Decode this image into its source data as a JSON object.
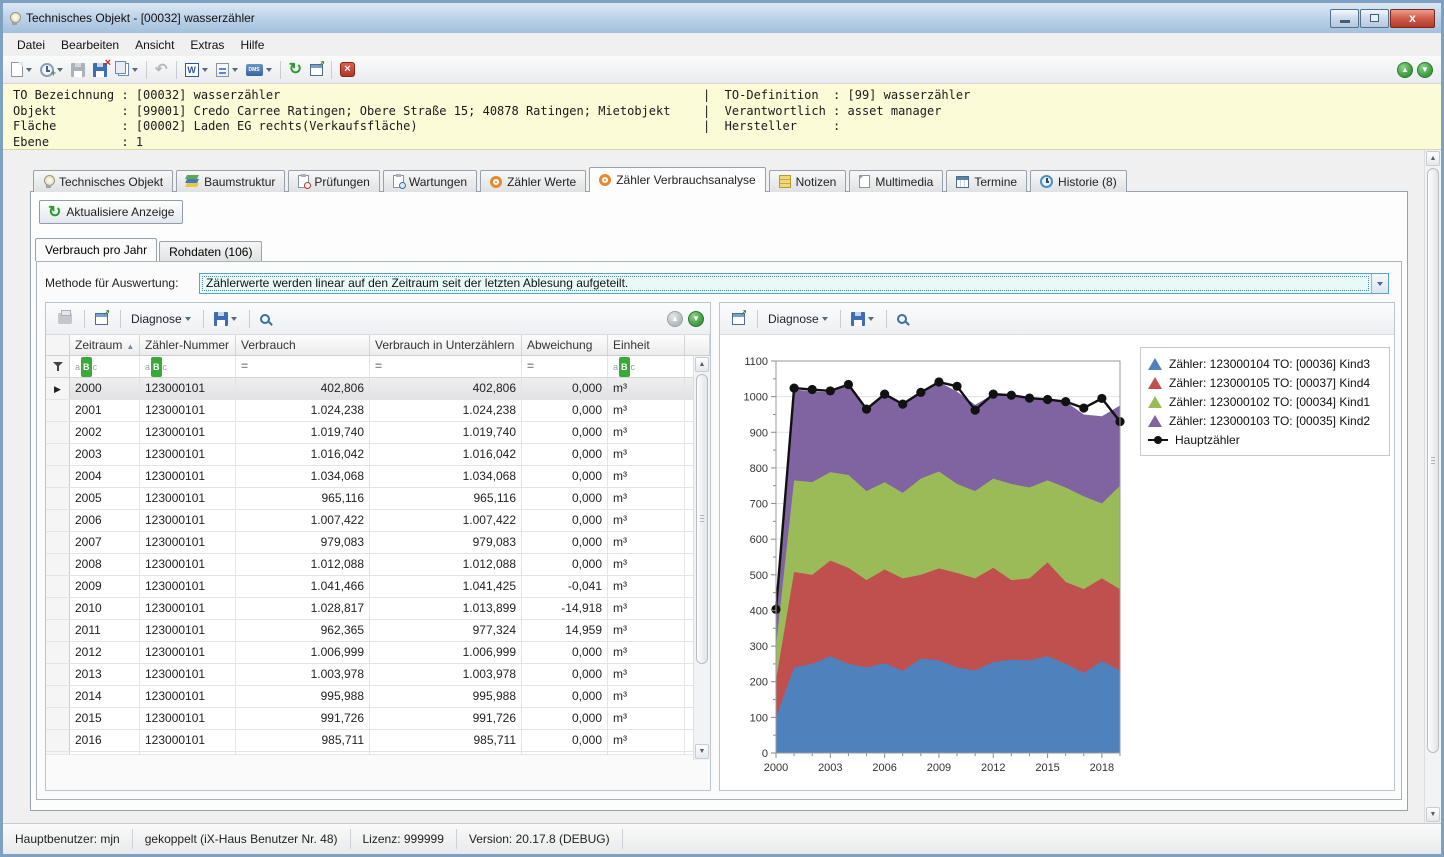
{
  "window": {
    "title": "Technisches Objekt - [00032] wasserzähler"
  },
  "menu": {
    "items": [
      "Datei",
      "Bearbeiten",
      "Ansicht",
      "Extras",
      "Hilfe"
    ]
  },
  "toolbar": {
    "buttons": [
      {
        "icon": "new-document-icon",
        "dropdown": true
      },
      {
        "icon": "history-clock-icon",
        "dropdown": true
      },
      {
        "icon": "save-icon",
        "disabled": true
      },
      {
        "icon": "save-discard-icon"
      },
      {
        "icon": "copy-icon",
        "dropdown": true
      },
      {
        "sep": true
      },
      {
        "icon": "undo-icon",
        "disabled": true,
        "glyph": "↶"
      },
      {
        "sep": true
      },
      {
        "icon": "word-export-icon",
        "dropdown": true,
        "glyph": "W"
      },
      {
        "icon": "list-report-icon",
        "dropdown": true
      },
      {
        "icon": "dms-icon",
        "dropdown": true,
        "glyph": "DMS"
      },
      {
        "sep": true
      },
      {
        "icon": "refresh-icon",
        "glyph": "↻"
      },
      {
        "icon": "detach-window-icon"
      },
      {
        "sep": true
      },
      {
        "icon": "delete-icon",
        "glyph": "×"
      }
    ],
    "nav_buttons": [
      {
        "icon": "nav-up-icon",
        "glyph": "▲"
      },
      {
        "icon": "nav-down-icon",
        "glyph": "▼"
      }
    ]
  },
  "info_panel": {
    "left_lines": [
      "TO Bezeichnung : [00032] wasserzähler",
      "Objekt         : [99001] Credo Carree Ratingen; Obere Straße 15; 40878 Ratingen; Mietobjekt",
      "Fläche         : [00002] Laden EG rechts(Verkaufsfläche)",
      "Ebene          : 1"
    ],
    "right_lines": [
      "|  TO-Definition  : [99] wasserzähler",
      "|  Verantwortlich : asset manager",
      "|  Hersteller     :"
    ]
  },
  "tabs": [
    {
      "label": "Technisches Objekt",
      "icon": "bulb-icon",
      "active": false
    },
    {
      "label": "Baumstruktur",
      "icon": "tree-layers-icon",
      "active": false
    },
    {
      "label": "Prüfungen",
      "icon": "clipboard-check-icon",
      "active": false
    },
    {
      "label": "Wartungen",
      "icon": "clipboard-search-icon",
      "active": false
    },
    {
      "label": "Zähler Werte",
      "icon": "meter-icon",
      "active": false
    },
    {
      "label": "Zähler Verbrauchsanalyse",
      "icon": "meter-icon",
      "active": true
    },
    {
      "label": "Notizen",
      "icon": "notes-icon",
      "active": false
    },
    {
      "label": "Multimedia",
      "icon": "multimedia-icon",
      "active": false
    },
    {
      "label": "Termine",
      "icon": "calendar-icon",
      "active": false
    },
    {
      "label": "Historie (8)",
      "icon": "history-tab-icon",
      "active": false
    }
  ],
  "actions": {
    "refresh_view": "Aktualisiere Anzeige"
  },
  "sub_tabs": [
    {
      "label": "Verbrauch pro Jahr",
      "active": true
    },
    {
      "label": "Rohdaten (106)",
      "active": false
    }
  ],
  "methode": {
    "label": "Methode für Auswertung:",
    "value": "Zählerwerte werden linear auf den Zeitraum seit der letzten Ablesung aufgeteilt."
  },
  "grid_toolbar_left": {
    "buttons": [
      {
        "icon": "print-icon",
        "disabled": true
      },
      {
        "icon": "detach-window-icon"
      },
      {
        "label": "Diagnose",
        "dropdown": true
      },
      {
        "icon": "save-layout-icon",
        "dropdown": true
      },
      {
        "icon": "search-icon"
      }
    ],
    "nav": [
      {
        "icon": "up-circle-icon",
        "disabled": true,
        "glyph": "▲"
      },
      {
        "icon": "down-circle-icon",
        "glyph": "▼"
      }
    ]
  },
  "grid_toolbar_right": {
    "buttons": [
      {
        "icon": "detach-window-icon"
      },
      {
        "label": "Diagnose",
        "dropdown": true
      },
      {
        "icon": "save-layout-icon",
        "dropdown": true
      },
      {
        "icon": "search-icon"
      }
    ]
  },
  "table": {
    "columns": [
      {
        "label": "Zeitraum",
        "sort": "asc",
        "filter": "abc",
        "align": "left"
      },
      {
        "label": "Zähler-Nummer",
        "filter": "abc",
        "align": "left"
      },
      {
        "label": "Verbrauch",
        "filter": "eq",
        "align": "right"
      },
      {
        "label": "Verbrauch in Unterzählern",
        "filter": "eq",
        "align": "right"
      },
      {
        "label": "Abweichung",
        "filter": "eq",
        "align": "right"
      },
      {
        "label": "Einheit",
        "filter": "abc",
        "align": "left"
      }
    ],
    "rows": [
      {
        "zeitraum": "2000",
        "nummer": "123000101",
        "verbrauch": "402,806",
        "unterzaehler": "402,806",
        "abweichung": "0,000",
        "einheit": "m³",
        "selected": true
      },
      {
        "zeitraum": "2001",
        "nummer": "123000101",
        "verbrauch": "1.024,238",
        "unterzaehler": "1.024,238",
        "abweichung": "0,000",
        "einheit": "m³"
      },
      {
        "zeitraum": "2002",
        "nummer": "123000101",
        "verbrauch": "1.019,740",
        "unterzaehler": "1.019,740",
        "abweichung": "0,000",
        "einheit": "m³"
      },
      {
        "zeitraum": "2003",
        "nummer": "123000101",
        "verbrauch": "1.016,042",
        "unterzaehler": "1.016,042",
        "abweichung": "0,000",
        "einheit": "m³"
      },
      {
        "zeitraum": "2004",
        "nummer": "123000101",
        "verbrauch": "1.034,068",
        "unterzaehler": "1.034,068",
        "abweichung": "0,000",
        "einheit": "m³"
      },
      {
        "zeitraum": "2005",
        "nummer": "123000101",
        "verbrauch": "965,116",
        "unterzaehler": "965,116",
        "abweichung": "0,000",
        "einheit": "m³"
      },
      {
        "zeitraum": "2006",
        "nummer": "123000101",
        "verbrauch": "1.007,422",
        "unterzaehler": "1.007,422",
        "abweichung": "0,000",
        "einheit": "m³"
      },
      {
        "zeitraum": "2007",
        "nummer": "123000101",
        "verbrauch": "979,083",
        "unterzaehler": "979,083",
        "abweichung": "0,000",
        "einheit": "m³"
      },
      {
        "zeitraum": "2008",
        "nummer": "123000101",
        "verbrauch": "1.012,088",
        "unterzaehler": "1.012,088",
        "abweichung": "0,000",
        "einheit": "m³"
      },
      {
        "zeitraum": "2009",
        "nummer": "123000101",
        "verbrauch": "1.041,466",
        "unterzaehler": "1.041,425",
        "abweichung": "-0,041",
        "einheit": "m³"
      },
      {
        "zeitraum": "2010",
        "nummer": "123000101",
        "verbrauch": "1.028,817",
        "unterzaehler": "1.013,899",
        "abweichung": "-14,918",
        "einheit": "m³"
      },
      {
        "zeitraum": "2011",
        "nummer": "123000101",
        "verbrauch": "962,365",
        "unterzaehler": "977,324",
        "abweichung": "14,959",
        "einheit": "m³"
      },
      {
        "zeitraum": "2012",
        "nummer": "123000101",
        "verbrauch": "1.006,999",
        "unterzaehler": "1.006,999",
        "abweichung": "0,000",
        "einheit": "m³"
      },
      {
        "zeitraum": "2013",
        "nummer": "123000101",
        "verbrauch": "1.003,978",
        "unterzaehler": "1.003,978",
        "abweichung": "0,000",
        "einheit": "m³"
      },
      {
        "zeitraum": "2014",
        "nummer": "123000101",
        "verbrauch": "995,988",
        "unterzaehler": "995,988",
        "abweichung": "0,000",
        "einheit": "m³"
      },
      {
        "zeitraum": "2015",
        "nummer": "123000101",
        "verbrauch": "991,726",
        "unterzaehler": "991,726",
        "abweichung": "0,000",
        "einheit": "m³"
      },
      {
        "zeitraum": "2016",
        "nummer": "123000101",
        "verbrauch": "985,711",
        "unterzaehler": "985,711",
        "abweichung": "0,000",
        "einheit": "m³"
      }
    ]
  },
  "chart_data": {
    "type": "area",
    "stacked": true,
    "x": [
      2000,
      2001,
      2002,
      2003,
      2004,
      2005,
      2006,
      2007,
      2008,
      2009,
      2010,
      2011,
      2012,
      2013,
      2014,
      2015,
      2016,
      2017,
      2018,
      2019
    ],
    "x_major_ticks": [
      2000,
      2003,
      2006,
      2009,
      2012,
      2015,
      2018
    ],
    "ylim": [
      0,
      1100
    ],
    "ytick_step": 100,
    "grid": true,
    "legend_position": "right",
    "series": [
      {
        "name": "Zähler: 123000104 TO: [00036] Kind3",
        "color": "#4f81bd",
        "values": [
          100,
          240,
          250,
          272,
          250,
          240,
          252,
          230,
          265,
          260,
          240,
          232,
          255,
          262,
          260,
          272,
          250,
          225,
          258,
          232
        ]
      },
      {
        "name": "Zähler: 123000105 TO: [00037] Kind4",
        "color": "#c0504d",
        "values": [
          105,
          268,
          250,
          268,
          270,
          245,
          263,
          260,
          235,
          258,
          265,
          258,
          265,
          223,
          230,
          263,
          230,
          235,
          232,
          228
        ]
      },
      {
        "name": "Zähler: 123000102 TO: [00034] Kind1",
        "color": "#9bbb59",
        "values": [
          95,
          257,
          260,
          248,
          260,
          250,
          245,
          240,
          270,
          272,
          250,
          245,
          250,
          270,
          255,
          230,
          265,
          260,
          210,
          290
        ]
      },
      {
        "name": "Zähler: 123000103 TO: [00035] Kind2",
        "color": "#8064a2",
        "values": [
          103,
          255,
          255,
          224,
          252,
          228,
          245,
          248,
          240,
          251,
          259,
          242,
          237,
          249,
          251,
          227,
          241,
          230,
          245,
          225
        ]
      }
    ],
    "line": {
      "name": "Hauptzähler",
      "color": "#111111",
      "values": [
        403,
        1024,
        1020,
        1016,
        1034,
        965,
        1007,
        979,
        1012,
        1041,
        1029,
        962,
        1007,
        1004,
        996,
        992,
        986,
        968,
        995,
        930
      ]
    }
  },
  "status_bar": {
    "segments": [
      "Hauptbenutzer: mjn",
      "gekoppelt (iX-Haus Benutzer Nr. 48)",
      "Lizenz: 999999",
      "Version: 20.17.8 (DEBUG)"
    ]
  }
}
